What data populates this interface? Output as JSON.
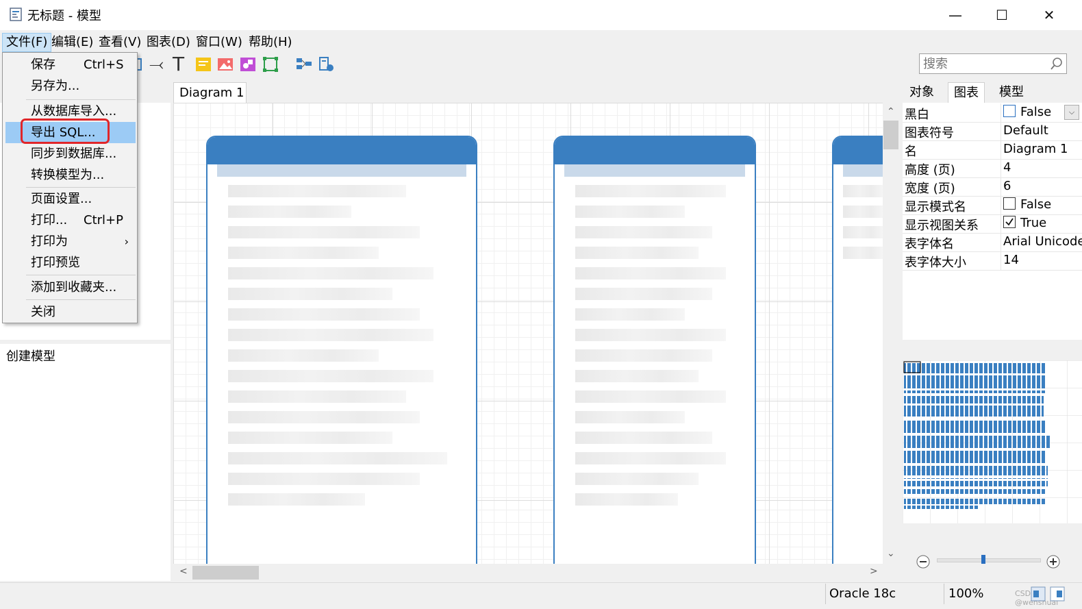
{
  "window": {
    "title": "无标题 - 模型",
    "minimize_glyph": "—",
    "maximize_glyph": "☐",
    "close_glyph": "✕"
  },
  "menubar": [
    {
      "label": "文件(F)"
    },
    {
      "label": "编辑(E)"
    },
    {
      "label": "查看(V)"
    },
    {
      "label": "图表(D)"
    },
    {
      "label": "窗口(W)"
    },
    {
      "label": "帮助(H)"
    }
  ],
  "toolbar": {
    "icons": [
      "table-icon",
      "relation-arrow-icon",
      "text-icon",
      "note-icon",
      "image-icon",
      "shape-icon",
      "layer-icon",
      "auto-layout-icon",
      "validate-icon"
    ],
    "text_tool_glyph": "T",
    "arrow_tool_glyph": "⤙"
  },
  "search": {
    "placeholder": "搜索"
  },
  "left_panel": {
    "bottom_label": "创建模型"
  },
  "diagram_tab": {
    "label": "Diagram 1"
  },
  "file_menu": {
    "items": [
      {
        "label": "保存",
        "shortcut": "Ctrl+S"
      },
      {
        "label": "另存为..."
      },
      {
        "label": "从数据库导入..."
      },
      {
        "label": "导出 SQL..."
      },
      {
        "label": "同步到数据库..."
      },
      {
        "label": "转换模型为..."
      },
      {
        "label": "页面设置..."
      },
      {
        "label": "打印...",
        "shortcut": "Ctrl+P"
      },
      {
        "label": "打印为",
        "submenu_glyph": "›"
      },
      {
        "label": "打印预览"
      },
      {
        "label": "添加到收藏夹..."
      },
      {
        "label": "关闭"
      }
    ]
  },
  "right_panel": {
    "tabs": [
      {
        "label": "对象"
      },
      {
        "label": "图表"
      },
      {
        "label": "模型"
      }
    ],
    "properties": [
      {
        "name": "黑白",
        "value": "False",
        "checked": false
      },
      {
        "name": "图表符号",
        "value": "Default"
      },
      {
        "name": "名",
        "value": "Diagram 1"
      },
      {
        "name": "高度 (页)",
        "value": "4"
      },
      {
        "name": "宽度 (页)",
        "value": "6"
      },
      {
        "name": "显示模式名",
        "value": "False",
        "checked": false
      },
      {
        "name": "显示视图关系",
        "value": "True",
        "checked": true
      },
      {
        "name": "表字体名",
        "value": "Arial Unicode MS"
      },
      {
        "name": "表字体大小",
        "value": "14"
      }
    ],
    "dropdown_glyph": "⌵"
  },
  "scroll": {
    "up": "⌃",
    "down": "⌄",
    "left": "<",
    "right": ">"
  },
  "zoom": {
    "level_fraction": 0.45
  },
  "statusbar": {
    "db": "Oracle 18c",
    "zoom": "100%",
    "watermark": "CSDN @wenshuai"
  },
  "colors": {
    "accent": "#3a7fc1",
    "menu_highlight": "#9ccbf5",
    "annotation_outline": "#e0262a"
  }
}
